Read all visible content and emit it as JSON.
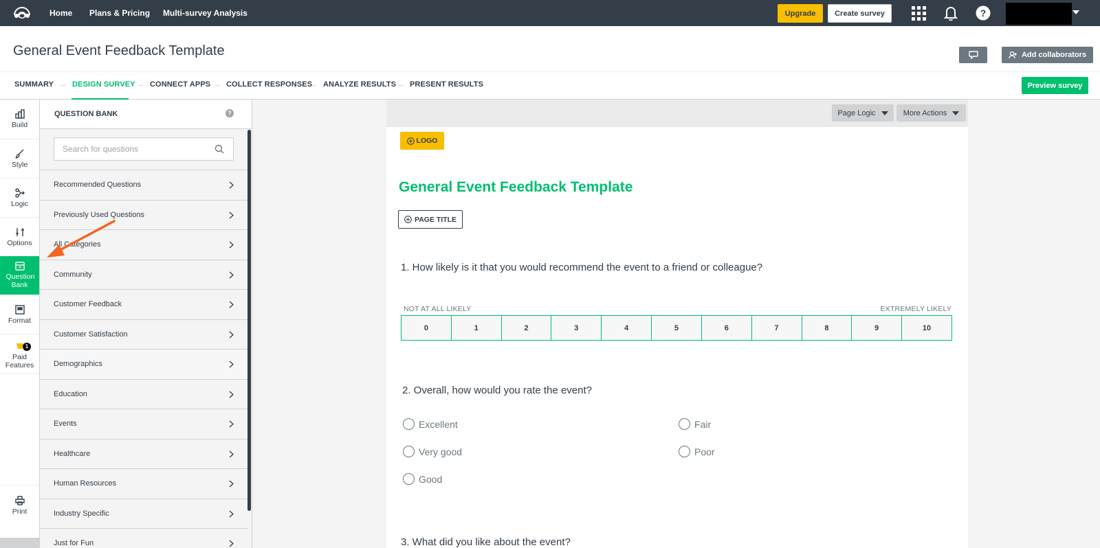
{
  "topbar": {
    "nav": [
      "Home",
      "Plans & Pricing",
      "Multi-survey Analysis"
    ],
    "upgrade_label": "Upgrade",
    "create_label": "Create survey",
    "icons": [
      "apps-grid-icon",
      "bell-icon",
      "help-icon"
    ]
  },
  "header": {
    "title": "General Event Feedback Template",
    "collab_label": "Add collaborators"
  },
  "steps": {
    "items": [
      "SUMMARY",
      "DESIGN SURVEY",
      "CONNECT APPS",
      "COLLECT RESPONSES",
      "ANALYZE RESULTS",
      "PRESENT RESULTS"
    ],
    "active": "DESIGN SURVEY",
    "preview_label": "Preview survey"
  },
  "rail": {
    "items": [
      "Build",
      "Style",
      "Logic",
      "Options",
      "Question Bank",
      "Format",
      "Paid Features",
      "Print"
    ],
    "active": "Question Bank",
    "paid_badge": "1"
  },
  "question_bank": {
    "title": "QUESTION BANK",
    "help": "?",
    "search_placeholder": "Search for questions",
    "categories": [
      "Recommended Questions",
      "Previously Used Questions",
      "All Categories",
      "Community",
      "Customer Feedback",
      "Customer Satisfaction",
      "Demographics",
      "Education",
      "Events",
      "Healthcare",
      "Human Resources",
      "Industry Specific",
      "Just for Fun"
    ]
  },
  "canvas": {
    "page_logic_label": "Page Logic",
    "more_actions_label": "More Actions",
    "logo_label": "LOGO",
    "heading": "General Event Feedback Template",
    "page_title_label": "PAGE TITLE",
    "q1": {
      "text": "1. How likely is it that you would recommend the event to a friend or colleague?",
      "low_label": "NOT AT ALL LIKELY",
      "high_label": "EXTREMELY LIKELY",
      "scale": [
        "0",
        "1",
        "2",
        "3",
        "4",
        "5",
        "6",
        "7",
        "8",
        "9",
        "10"
      ]
    },
    "q2": {
      "text": "2. Overall, how would you rate the event?",
      "options": [
        "Excellent",
        "Very good",
        "Good",
        "Fair",
        "Poor"
      ]
    },
    "q3": {
      "text": "3. What did you like about the event?"
    }
  },
  "colors": {
    "brand_green": "#00bf6f",
    "topbar": "#333e48",
    "upgrade": "#f9be00",
    "annotation_arrow": "#f26522"
  }
}
